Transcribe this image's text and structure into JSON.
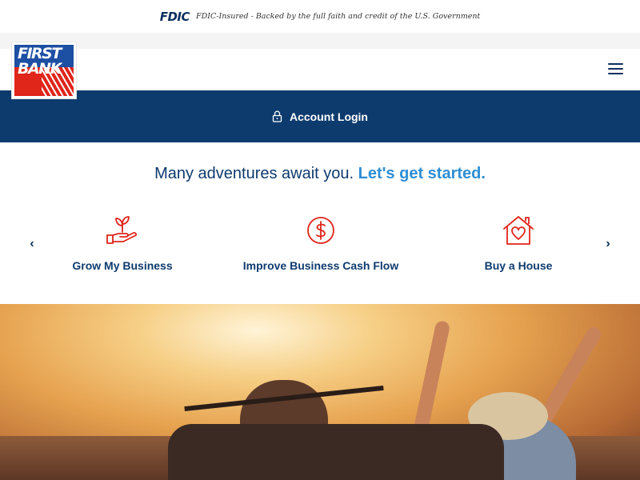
{
  "fdic": {
    "logo_text": "FDIC",
    "statement": "FDIC-Insured - Backed by the full faith and credit of the U.S. Government"
  },
  "brand": {
    "logo_lettering": [
      "FIRST",
      "BANK"
    ],
    "colors": {
      "navy": "#0e3b6e",
      "blue": "#2f8ed4",
      "red": "#e0251b",
      "logo_blue": "#1d4fa3"
    }
  },
  "nav": {
    "menu_icon": "hamburger-menu-icon"
  },
  "login": {
    "label": "Account Login",
    "icon": "lock-icon"
  },
  "headline": {
    "part1": "Many adventures await you.",
    "part2": "Let's get started."
  },
  "carousel": {
    "prev_icon": "chevron-left-icon",
    "next_icon": "chevron-right-icon",
    "items": [
      {
        "label": "Grow My Business",
        "icon": "hand-sprout-icon"
      },
      {
        "label": "Improve Business Cash Flow",
        "icon": "dollar-circle-icon"
      },
      {
        "label": "Buy a House",
        "icon": "house-heart-icon"
      }
    ]
  },
  "hero": {
    "image": "people-in-convertible-sunset-photo"
  }
}
